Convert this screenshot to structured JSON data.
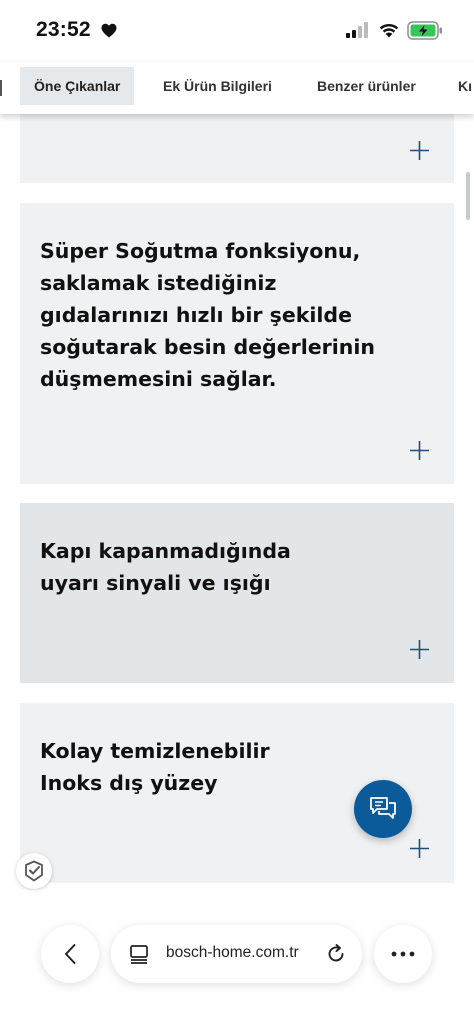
{
  "status_bar": {
    "time": "23:52",
    "icons": [
      "heart-icon",
      "signal-icon",
      "wifi-icon",
      "battery-charging-icon"
    ]
  },
  "tabs": [
    {
      "label": "Öne Çıkanlar",
      "active": true
    },
    {
      "label": "Ek Ürün Bilgileri",
      "active": false
    },
    {
      "label": "Benzer ürünler",
      "active": false
    },
    {
      "label": "Kı",
      "active": false
    }
  ],
  "cards": [
    {
      "title": "",
      "icon": "plus-icon"
    },
    {
      "title": "Süper Soğutma fonksiyonu, saklamak istediğiniz gıdalarınızı hızlı bir şekilde soğutarak besin değerlerinin düşmemesini sağlar.",
      "icon": "plus-icon"
    },
    {
      "title": "Kapı kapanmadığında uyarı sinyali ve ışığı",
      "icon": "plus-icon"
    },
    {
      "title": "Kolay temizlenebilir Inoks dış yüzey",
      "icon": "plus-icon"
    }
  ],
  "chat_button": {
    "icon": "chat-icon"
  },
  "trust_badge": {
    "icon": "checkmark-badge-icon"
  },
  "browser": {
    "url": "bosch-home.com.tr",
    "back_icon": "chevron-left-icon",
    "page_icon": "page-menu-icon",
    "reload_icon": "reload-icon",
    "more_icon": "more-dots-icon"
  },
  "colors": {
    "accent": "#0b5b9b",
    "card_bg": "#eff1f3",
    "card_bg_alt": "#e3e6e9",
    "active_tab_bg": "#e6e9ec",
    "battery_green": "#34c759"
  }
}
